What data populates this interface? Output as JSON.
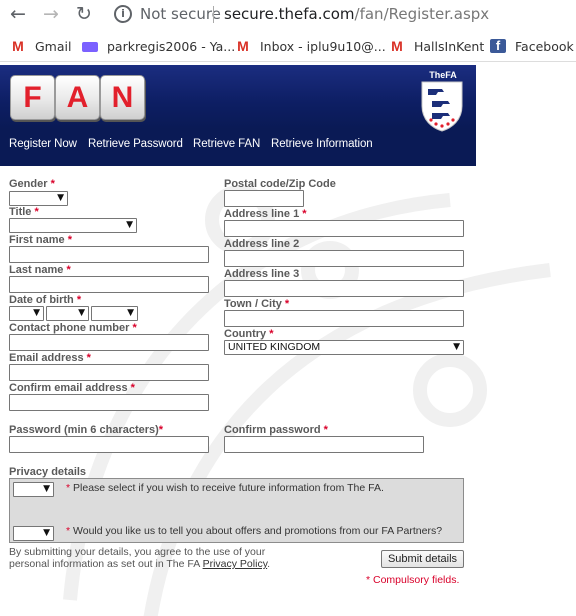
{
  "browser": {
    "security_label": "Not secure",
    "url_host": "secure.thefa.com",
    "url_path": "/fan/Register.aspx",
    "bookmarks": [
      {
        "label": "Gmail",
        "icon": "gmail-icon"
      },
      {
        "label": "parkregis2006 - Ya...",
        "icon": "mail-icon"
      },
      {
        "label": "Inbox - iplu9u10@...",
        "icon": "gmail-icon"
      },
      {
        "label": "HallsInKent",
        "icon": "gmail-icon"
      },
      {
        "label": "Facebook",
        "icon": "facebook-icon"
      }
    ]
  },
  "header": {
    "logo_letters": [
      "F",
      "A",
      "N"
    ],
    "crest_label": "TheFA",
    "nav": [
      "Register Now",
      "Retrieve Password",
      "Retrieve FAN",
      "Retrieve Information"
    ]
  },
  "form": {
    "gender_label": "Gender",
    "title_label": "Title",
    "first_name_label": "First name",
    "last_name_label": "Last name",
    "dob_label": "Date of birth",
    "phone_label": "Contact phone number",
    "email_label": "Email address",
    "confirm_email_label": "Confirm email address",
    "password_label": "Password (min 6 characters)",
    "confirm_password_label": "Confirm password",
    "postal_label": "Postal code/Zip Code",
    "address1_label": "Address line 1",
    "address2_label": "Address line 2",
    "address3_label": "Address line 3",
    "town_label": "Town / City",
    "country_label": "Country",
    "country_value": "UNITED KINGDOM",
    "required_mark": "*"
  },
  "privacy": {
    "heading": "Privacy details",
    "q1": "Please select if you wish to receive future information from The FA.",
    "q2": "Would you like us to tell you about offers and promotions from our FA Partners?"
  },
  "footer": {
    "disclaimer_line1": "By submitting your details, you agree to the use of your",
    "disclaimer_line2_prefix": "personal information as set out in The FA",
    "privacy_link": "Privacy Policy",
    "disclaimer_line2_suffix": ".",
    "submit_label": "Submit details",
    "compulsory_note": "* Compulsory fields."
  },
  "colors": {
    "header_navy": "#0a1a55",
    "required_red": "#d9002a",
    "logo_red": "#e2202c"
  }
}
